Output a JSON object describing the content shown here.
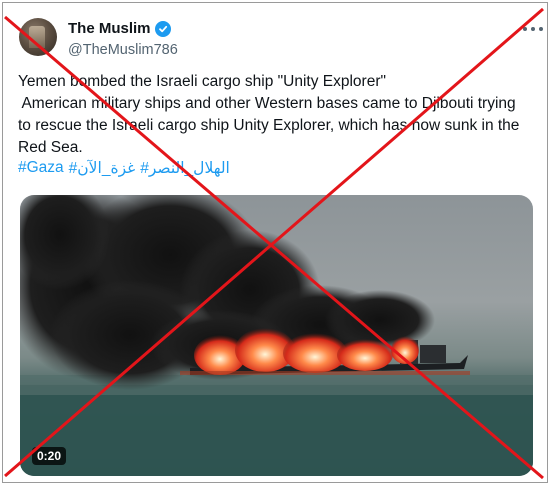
{
  "tweet": {
    "display_name": "The Muslim",
    "handle": "@TheMuslim786",
    "text_lines": [
      "Yemen bombed the Israeli cargo ship \"Unity Explorer\"",
      " American military ships and other Western bases came to Djibouti trying",
      "to rescue the Israeli cargo ship Unity Explorer, which has now sunk in the",
      "Red Sea."
    ],
    "hashtags": [
      "#Gaza",
      "#غزة_الآن",
      "#الهلال_النصر"
    ]
  },
  "media": {
    "duration": "0:20"
  },
  "icons": {
    "avatar": "profile-avatar",
    "verified": "verified-badge-icon",
    "more": "more-options-icon",
    "overlay": "red-cross-overlay"
  },
  "colors": {
    "link": "#1d9bf0",
    "cross": "#e3151a"
  }
}
